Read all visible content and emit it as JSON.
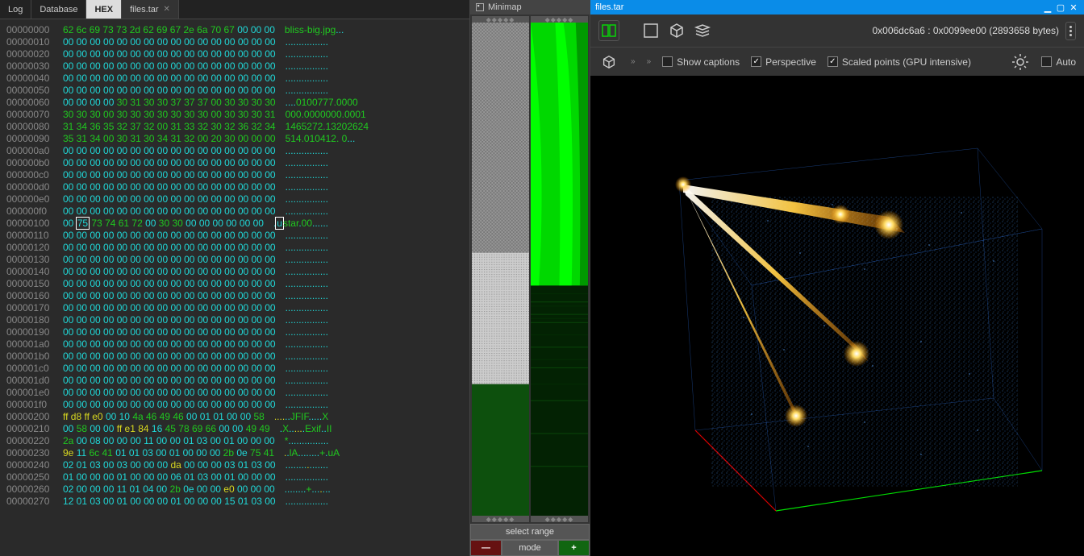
{
  "tabs": {
    "log": "Log",
    "database": "Database",
    "hex": "HEX",
    "file": "files.tar"
  },
  "titlebar": {
    "file": "files.tar"
  },
  "minimap": {
    "title": "Minimap",
    "select_range": "select range",
    "mode": "mode"
  },
  "toolbar": {
    "range": "0x006dc6a6 : 0x0099ee00 (2893658 bytes)",
    "show_captions": "Show captions",
    "perspective": "Perspective",
    "scaled_points": "Scaled points (GPU intensive)",
    "auto": "Auto"
  },
  "hex": [
    {
      "o": "00000000",
      "h": [
        [
          "62 6c 69 73 73 2d 62 69 67 2e 6a 70 67",
          "g"
        ],
        [
          " 00 00 00",
          "c"
        ]
      ],
      "a": [
        [
          "bliss-big.jpg",
          "g"
        ],
        [
          "...",
          "c"
        ]
      ]
    },
    {
      "o": "00000010",
      "h": [
        [
          "00 00 00 00 00 00 00 00 00 00 00 00 00 00 00 00",
          "c"
        ]
      ],
      "a": [
        [
          "................",
          "c"
        ]
      ]
    },
    {
      "o": "00000020",
      "h": [
        [
          "00 00 00 00 00 00 00 00 00 00 00 00 00 00 00 00",
          "c"
        ]
      ],
      "a": [
        [
          "................",
          "c"
        ]
      ]
    },
    {
      "o": "00000030",
      "h": [
        [
          "00 00 00 00 00 00 00 00 00 00 00 00 00 00 00 00",
          "c"
        ]
      ],
      "a": [
        [
          "................",
          "c"
        ]
      ]
    },
    {
      "o": "00000040",
      "h": [
        [
          "00 00 00 00 00 00 00 00 00 00 00 00 00 00 00 00",
          "c"
        ]
      ],
      "a": [
        [
          "................",
          "c"
        ]
      ]
    },
    {
      "o": "00000050",
      "h": [
        [
          "00 00 00 00 00 00 00 00 00 00 00 00 00 00 00 00",
          "c"
        ]
      ],
      "a": [
        [
          "................",
          "c"
        ]
      ]
    },
    {
      "o": "00000060",
      "h": [
        [
          "00 00 00 00 ",
          "c"
        ],
        [
          "30 31 30 30 37 37 37 00 30 30 30 30",
          "g"
        ]
      ],
      "a": [
        [
          "....",
          "c"
        ],
        [
          "0100777.0000",
          "g"
        ]
      ]
    },
    {
      "o": "00000070",
      "h": [
        [
          "30 30 30 00 30 30 30 30 30 30 30 00 30 30 30 31",
          "g"
        ]
      ],
      "a": [
        [
          "000.0000000.0001",
          "g"
        ]
      ]
    },
    {
      "o": "00000080",
      "h": [
        [
          "31 34 36 35 32 37 32 00 31 33 32 30 32 36 32 34",
          "g"
        ]
      ],
      "a": [
        [
          "1465272.13202624",
          "g"
        ]
      ]
    },
    {
      "o": "00000090",
      "h": [
        [
          "35 31 34 00 30 31 30 34 31 32 00 20 30 00 00 00",
          "g"
        ]
      ],
      "a": [
        [
          "514.010412. 0",
          "g"
        ],
        [
          "...",
          "c"
        ]
      ]
    },
    {
      "o": "000000a0",
      "h": [
        [
          "00 00 00 00 00 00 00 00 00 00 00 00 00 00 00 00",
          "c"
        ]
      ],
      "a": [
        [
          "................",
          "c"
        ]
      ]
    },
    {
      "o": "000000b0",
      "h": [
        [
          "00 00 00 00 00 00 00 00 00 00 00 00 00 00 00 00",
          "c"
        ]
      ],
      "a": [
        [
          "................",
          "c"
        ]
      ]
    },
    {
      "o": "000000c0",
      "h": [
        [
          "00 00 00 00 00 00 00 00 00 00 00 00 00 00 00 00",
          "c"
        ]
      ],
      "a": [
        [
          "................",
          "c"
        ]
      ]
    },
    {
      "o": "000000d0",
      "h": [
        [
          "00 00 00 00 00 00 00 00 00 00 00 00 00 00 00 00",
          "c"
        ]
      ],
      "a": [
        [
          "................",
          "c"
        ]
      ]
    },
    {
      "o": "000000e0",
      "h": [
        [
          "00 00 00 00 00 00 00 00 00 00 00 00 00 00 00 00",
          "c"
        ]
      ],
      "a": [
        [
          "................",
          "c"
        ]
      ]
    },
    {
      "o": "000000f0",
      "h": [
        [
          "00 00 00 00 00 00 00 00 00 00 00 00 00 00 00 00",
          "c"
        ]
      ],
      "a": [
        [
          "................",
          "c"
        ]
      ]
    },
    {
      "o": "00000100",
      "h": [
        [
          "00 ",
          "c"
        ],
        [
          "75",
          "cur"
        ],
        [
          " 73 74 61 72 ",
          "g"
        ],
        [
          "00 ",
          "c"
        ],
        [
          "30 30 ",
          "g"
        ],
        [
          "00 00 00 00 00 00",
          "c"
        ]
      ],
      "a": [
        [
          ".",
          "c"
        ],
        [
          "u",
          "cur"
        ],
        [
          "star",
          "g"
        ],
        [
          ".",
          "c"
        ],
        [
          "00",
          "g"
        ],
        [
          "......",
          "c"
        ]
      ]
    },
    {
      "o": "00000110",
      "h": [
        [
          "00 00 00 00 00 00 00 00 00 00 00 00 00 00 00 00",
          "c"
        ]
      ],
      "a": [
        [
          "................",
          "c"
        ]
      ]
    },
    {
      "o": "00000120",
      "h": [
        [
          "00 00 00 00 00 00 00 00 00 00 00 00 00 00 00 00",
          "c"
        ]
      ],
      "a": [
        [
          "................",
          "c"
        ]
      ]
    },
    {
      "o": "00000130",
      "h": [
        [
          "00 00 00 00 00 00 00 00 00 00 00 00 00 00 00 00",
          "c"
        ]
      ],
      "a": [
        [
          "................",
          "c"
        ]
      ]
    },
    {
      "o": "00000140",
      "h": [
        [
          "00 00 00 00 00 00 00 00 00 00 00 00 00 00 00 00",
          "c"
        ]
      ],
      "a": [
        [
          "................",
          "c"
        ]
      ]
    },
    {
      "o": "00000150",
      "h": [
        [
          "00 00 00 00 00 00 00 00 00 00 00 00 00 00 00 00",
          "c"
        ]
      ],
      "a": [
        [
          "................",
          "c"
        ]
      ]
    },
    {
      "o": "00000160",
      "h": [
        [
          "00 00 00 00 00 00 00 00 00 00 00 00 00 00 00 00",
          "c"
        ]
      ],
      "a": [
        [
          "................",
          "c"
        ]
      ]
    },
    {
      "o": "00000170",
      "h": [
        [
          "00 00 00 00 00 00 00 00 00 00 00 00 00 00 00 00",
          "c"
        ]
      ],
      "a": [
        [
          "................",
          "c"
        ]
      ]
    },
    {
      "o": "00000180",
      "h": [
        [
          "00 00 00 00 00 00 00 00 00 00 00 00 00 00 00 00",
          "c"
        ]
      ],
      "a": [
        [
          "................",
          "c"
        ]
      ]
    },
    {
      "o": "00000190",
      "h": [
        [
          "00 00 00 00 00 00 00 00 00 00 00 00 00 00 00 00",
          "c"
        ]
      ],
      "a": [
        [
          "................",
          "c"
        ]
      ]
    },
    {
      "o": "000001a0",
      "h": [
        [
          "00 00 00 00 00 00 00 00 00 00 00 00 00 00 00 00",
          "c"
        ]
      ],
      "a": [
        [
          "................",
          "c"
        ]
      ]
    },
    {
      "o": "000001b0",
      "h": [
        [
          "00 00 00 00 00 00 00 00 00 00 00 00 00 00 00 00",
          "c"
        ]
      ],
      "a": [
        [
          "................",
          "c"
        ]
      ]
    },
    {
      "o": "000001c0",
      "h": [
        [
          "00 00 00 00 00 00 00 00 00 00 00 00 00 00 00 00",
          "c"
        ]
      ],
      "a": [
        [
          "................",
          "c"
        ]
      ]
    },
    {
      "o": "000001d0",
      "h": [
        [
          "00 00 00 00 00 00 00 00 00 00 00 00 00 00 00 00",
          "c"
        ]
      ],
      "a": [
        [
          "................",
          "c"
        ]
      ]
    },
    {
      "o": "000001e0",
      "h": [
        [
          "00 00 00 00 00 00 00 00 00 00 00 00 00 00 00 00",
          "c"
        ]
      ],
      "a": [
        [
          "................",
          "c"
        ]
      ]
    },
    {
      "o": "000001f0",
      "h": [
        [
          "00 00 00 00 00 00 00 00 00 00 00 00 00 00 00 00",
          "c"
        ]
      ],
      "a": [
        [
          "................",
          "c"
        ]
      ]
    },
    {
      "o": "00000200",
      "h": [
        [
          "ff d8 ff e0 ",
          "y"
        ],
        [
          "00 10 ",
          "c"
        ],
        [
          "4a 46 49 46 ",
          "g"
        ],
        [
          "00 01 01 00 00 ",
          "c"
        ],
        [
          "58",
          "g"
        ]
      ],
      "a": [
        [
          "....",
          "y"
        ],
        [
          "..",
          "c"
        ],
        [
          "JFIF",
          "g"
        ],
        [
          ".....",
          "c"
        ],
        [
          "X",
          "g"
        ]
      ]
    },
    {
      "o": "00000210",
      "h": [
        [
          "00 ",
          "c"
        ],
        [
          "58 ",
          "g"
        ],
        [
          "00 00 ",
          "c"
        ],
        [
          "ff e1 84 ",
          "y"
        ],
        [
          "16 ",
          "c"
        ],
        [
          "45 78 69 66 ",
          "g"
        ],
        [
          "00 00 ",
          "c"
        ],
        [
          "49 49",
          "g"
        ]
      ],
      "a": [
        [
          ".",
          "c"
        ],
        [
          "X",
          "g"
        ],
        [
          "..",
          "c"
        ],
        [
          "...",
          "y"
        ],
        [
          ".",
          "c"
        ],
        [
          "Exif",
          "g"
        ],
        [
          "..",
          "c"
        ],
        [
          "II",
          "g"
        ]
      ]
    },
    {
      "o": "00000220",
      "h": [
        [
          "2a ",
          "g"
        ],
        [
          "00 08 00 00 00 11 00 00 01 03 00 01 00 00 00",
          "c"
        ]
      ],
      "a": [
        [
          "*",
          "g"
        ],
        [
          "...............",
          "c"
        ]
      ]
    },
    {
      "o": "00000230",
      "h": [
        [
          "9e ",
          "y"
        ],
        [
          "11 ",
          "c"
        ],
        [
          "6c 41 ",
          "g"
        ],
        [
          "01 01 03 00 01 00 00 00 ",
          "c"
        ],
        [
          "2b ",
          "g"
        ],
        [
          "0e ",
          "c"
        ],
        [
          "75 41",
          "g"
        ]
      ],
      "a": [
        [
          ".",
          "y"
        ],
        [
          ".",
          "c"
        ],
        [
          "lA",
          "g"
        ],
        [
          "........",
          "c"
        ],
        [
          "+",
          "g"
        ],
        [
          ".",
          "c"
        ],
        [
          "uA",
          "g"
        ]
      ]
    },
    {
      "o": "00000240",
      "h": [
        [
          "02 01 03 00 03 00 00 00 ",
          "c"
        ],
        [
          "da ",
          "y"
        ],
        [
          "00 00 00 03 01 03 00",
          "c"
        ]
      ],
      "a": [
        [
          "........",
          "c"
        ],
        [
          ".",
          "y"
        ],
        [
          ".......",
          "c"
        ]
      ]
    },
    {
      "o": "00000250",
      "h": [
        [
          "01 00 00 00 01 00 00 00 06 01 03 00 01 00 00 00",
          "c"
        ]
      ],
      "a": [
        [
          "................",
          "c"
        ]
      ]
    },
    {
      "o": "00000260",
      "h": [
        [
          "02 00 00 00 11 01 04 00 ",
          "c"
        ],
        [
          "2b ",
          "g"
        ],
        [
          "0e 00 00 ",
          "c"
        ],
        [
          "e0 ",
          "y"
        ],
        [
          "00 00 00",
          "c"
        ]
      ],
      "a": [
        [
          "........",
          "c"
        ],
        [
          "+",
          "g"
        ],
        [
          "...",
          "c"
        ],
        [
          ".",
          "y"
        ],
        [
          "...",
          "c"
        ]
      ]
    },
    {
      "o": "00000270",
      "h": [
        [
          "12 01 03 00 01 00 00 00 01 00 00 00 15 01 03 00",
          "c"
        ]
      ],
      "a": [
        [
          "................",
          "c"
        ]
      ]
    }
  ]
}
